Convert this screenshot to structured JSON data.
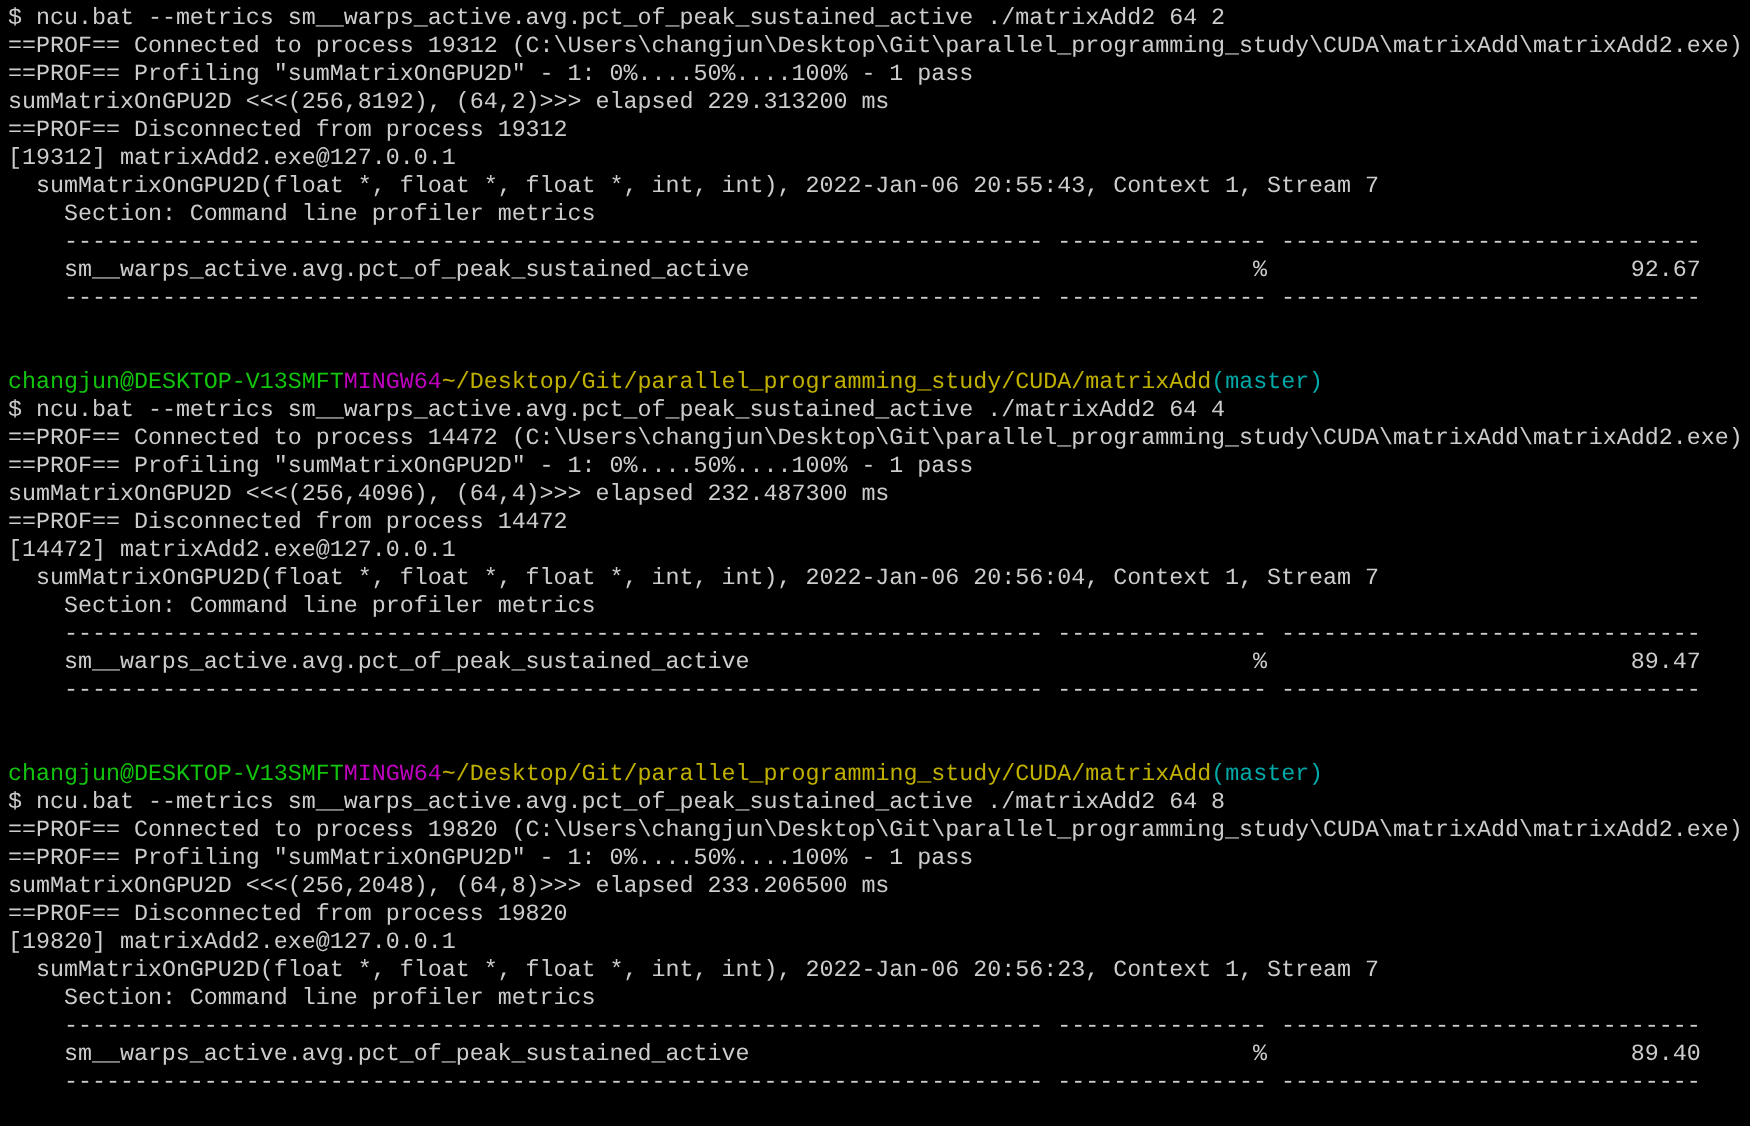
{
  "terminal": {
    "blocks": [
      {
        "command": "$ ncu.bat --metrics sm__warps_active.avg.pct_of_peak_sustained_active ./matrixAdd2 64 2",
        "output": [
          {
            "kind": "text",
            "text": "==PROF== Connected to process 19312 (C:\\Users\\changjun\\Desktop\\Git\\parallel_programming_study\\CUDA\\matrixAdd\\matrixAdd2.exe)"
          },
          {
            "kind": "text",
            "text": "==PROF== Profiling \"sumMatrixOnGPU2D\" - 1: 0%....50%....100% - 1 pass"
          },
          {
            "kind": "text",
            "text": "sumMatrixOnGPU2D <<<(256,8192), (64,2)>>> elapsed 229.313200 ms"
          },
          {
            "kind": "text",
            "text": "==PROF== Disconnected from process 19312"
          },
          {
            "kind": "text",
            "text": "[19312] matrixAdd2.exe@127.0.0.1"
          },
          {
            "kind": "text",
            "text": "  sumMatrixOnGPU2D(float *, float *, float *, int, int), 2022-Jan-06 20:55:43, Context 1, Stream 7"
          },
          {
            "kind": "text",
            "text": "    Section: Command line profiler metrics"
          },
          {
            "kind": "rule",
            "text": "    ---------------------------------------------------------------------- --------------- ------------------------------"
          },
          {
            "kind": "metric",
            "name": "sm__warps_active.avg.pct_of_peak_sustained_active",
            "unit": "%",
            "value": "92.67"
          },
          {
            "kind": "rule",
            "text": "    ---------------------------------------------------------------------- --------------- ------------------------------"
          }
        ]
      },
      {
        "prompt": {
          "user_host": "changjun@DESKTOP-V13SMFT",
          "shell": "MINGW64",
          "path": "~/Desktop/Git/parallel_programming_study/CUDA/matrixAdd",
          "branch": "(master)"
        },
        "command": "$ ncu.bat --metrics sm__warps_active.avg.pct_of_peak_sustained_active ./matrixAdd2 64 4",
        "output": [
          {
            "kind": "text",
            "text": "==PROF== Connected to process 14472 (C:\\Users\\changjun\\Desktop\\Git\\parallel_programming_study\\CUDA\\matrixAdd\\matrixAdd2.exe)"
          },
          {
            "kind": "text",
            "text": "==PROF== Profiling \"sumMatrixOnGPU2D\" - 1: 0%....50%....100% - 1 pass"
          },
          {
            "kind": "text",
            "text": "sumMatrixOnGPU2D <<<(256,4096), (64,4)>>> elapsed 232.487300 ms"
          },
          {
            "kind": "text",
            "text": "==PROF== Disconnected from process 14472"
          },
          {
            "kind": "text",
            "text": "[14472] matrixAdd2.exe@127.0.0.1"
          },
          {
            "kind": "text",
            "text": "  sumMatrixOnGPU2D(float *, float *, float *, int, int), 2022-Jan-06 20:56:04, Context 1, Stream 7"
          },
          {
            "kind": "text",
            "text": "    Section: Command line profiler metrics"
          },
          {
            "kind": "rule",
            "text": "    ---------------------------------------------------------------------- --------------- ------------------------------"
          },
          {
            "kind": "metric",
            "name": "sm__warps_active.avg.pct_of_peak_sustained_active",
            "unit": "%",
            "value": "89.47"
          },
          {
            "kind": "rule",
            "text": "    ---------------------------------------------------------------------- --------------- ------------------------------"
          }
        ]
      },
      {
        "prompt": {
          "user_host": "changjun@DESKTOP-V13SMFT",
          "shell": "MINGW64",
          "path": "~/Desktop/Git/parallel_programming_study/CUDA/matrixAdd",
          "branch": "(master)"
        },
        "command": "$ ncu.bat --metrics sm__warps_active.avg.pct_of_peak_sustained_active ./matrixAdd2 64 8",
        "output": [
          {
            "kind": "text",
            "text": "==PROF== Connected to process 19820 (C:\\Users\\changjun\\Desktop\\Git\\parallel_programming_study\\CUDA\\matrixAdd\\matrixAdd2.exe)"
          },
          {
            "kind": "text",
            "text": "==PROF== Profiling \"sumMatrixOnGPU2D\" - 1: 0%....50%....100% - 1 pass"
          },
          {
            "kind": "text",
            "text": "sumMatrixOnGPU2D <<<(256,2048), (64,8)>>> elapsed 233.206500 ms"
          },
          {
            "kind": "text",
            "text": "==PROF== Disconnected from process 19820"
          },
          {
            "kind": "text",
            "text": "[19820] matrixAdd2.exe@127.0.0.1"
          },
          {
            "kind": "text",
            "text": "  sumMatrixOnGPU2D(float *, float *, float *, int, int), 2022-Jan-06 20:56:23, Context 1, Stream 7"
          },
          {
            "kind": "text",
            "text": "    Section: Command line profiler metrics"
          },
          {
            "kind": "rule",
            "text": "    ---------------------------------------------------------------------- --------------- ------------------------------"
          },
          {
            "kind": "metric",
            "name": "sm__warps_active.avg.pct_of_peak_sustained_active",
            "unit": "%",
            "value": "89.40"
          },
          {
            "kind": "rule",
            "text": "    ---------------------------------------------------------------------- --------------- ------------------------------"
          }
        ]
      }
    ]
  }
}
